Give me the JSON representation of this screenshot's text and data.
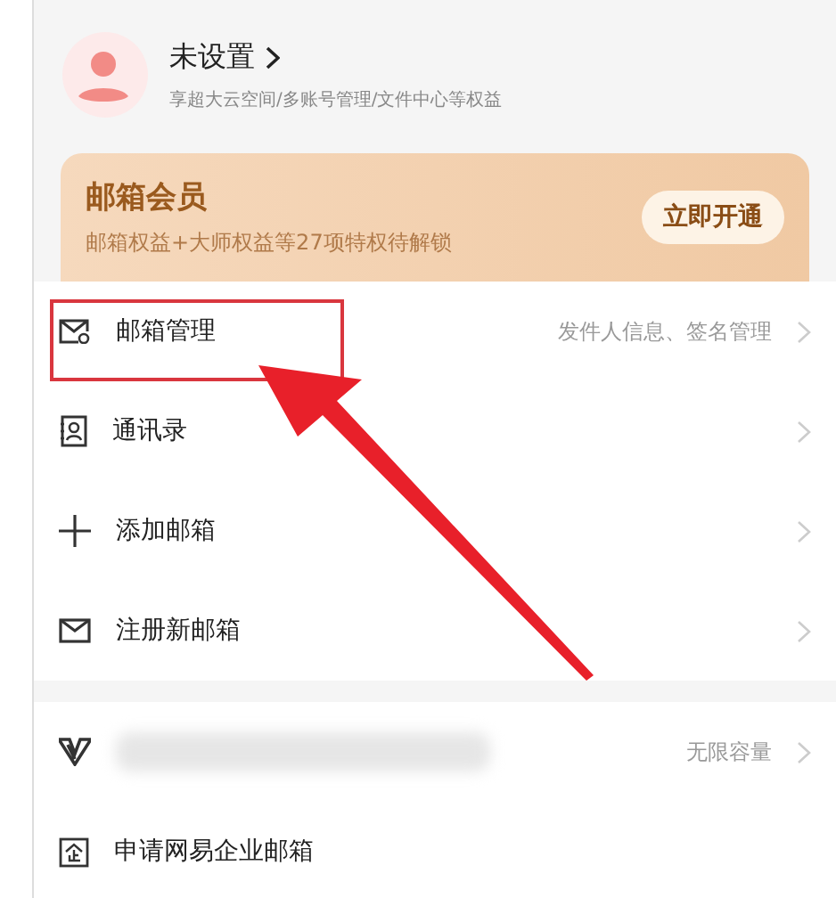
{
  "profile": {
    "name": "未设置",
    "subtitle": "享超大云空间/多账号管理/文件中心等权益"
  },
  "vip_card": {
    "title": "邮箱会员",
    "subtitle": "邮箱权益+大师权益等27项特权待解锁",
    "button": "立即开通"
  },
  "menu_groups": [
    {
      "items": [
        {
          "kind": "normal",
          "label": "邮箱管理",
          "detail": "发件人信息、签名管理",
          "highlighted": true
        },
        {
          "kind": "normal",
          "label": "通讯录",
          "highlighted": false
        },
        {
          "kind": "normal",
          "label": "添加邮箱",
          "highlighted": false
        },
        {
          "kind": "normal",
          "label": "注册新邮箱",
          "highlighted": false
        }
      ]
    },
    {
      "items": [
        {
          "kind": "blurred",
          "detail": "无限容量",
          "highlighted": false
        },
        {
          "kind": "normal",
          "label": "申请网易企业邮箱",
          "highlighted": false,
          "no_chevron": true
        }
      ]
    }
  ]
}
